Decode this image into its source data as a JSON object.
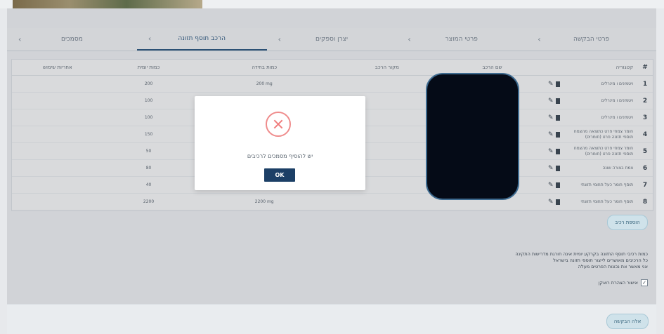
{
  "tabs": [
    {
      "label": "פרטי הבקשה"
    },
    {
      "label": "פרטי המוצר"
    },
    {
      "label": "יצרן וספקים"
    },
    {
      "label": "הרכב תוסף תזונה"
    },
    {
      "label": "מסמכים"
    }
  ],
  "table": {
    "headers": {
      "num": "#",
      "category": "קטגוריה",
      "name": "שם הרכב",
      "source": "מקור הרכב",
      "qty": "כמות בחידה",
      "daily_qty": "כמות יומית",
      "usage": "אחריות שימוש"
    },
    "rows": [
      {
        "num": "1",
        "category": "ויטמינים ו מינרלים",
        "qty": "200 mg",
        "daily": "200"
      },
      {
        "num": "2",
        "category": "ויטמינים ו מינרלים",
        "qty": "",
        "daily": "100"
      },
      {
        "num": "3",
        "category": "ויטמינים ו מינרלים",
        "qty": "",
        "daily": "100"
      },
      {
        "num": "4",
        "category": "חומר צמחי פרט כתוצאה מהצמח תוספי תזונה פרט (חומרים)",
        "qty": "",
        "daily": "150"
      },
      {
        "num": "5",
        "category": "חומר צמחי פרט כתוצאה מהצמח תוספי תזונה פרט (חומרים)",
        "qty": "",
        "daily": "50"
      },
      {
        "num": "6",
        "category": "צמח בצורה שונה",
        "qty": "",
        "daily": "80"
      },
      {
        "num": "7",
        "category": "תוסף חומר כעל תחומי תזונתי",
        "qty": "",
        "daily": "40"
      },
      {
        "num": "8",
        "category": "תוסף חומר כעל תחומי תזונתי",
        "qty": "2200 mg",
        "daily": "2200"
      }
    ]
  },
  "modal": {
    "message": "יש להוסיף מסמכים לרכיבים",
    "ok_label": "OK"
  },
  "add_button": "הוספת רכיב",
  "info_lines": [
    "כמות רכיבי תוסף התזונה בקרקע יומית אינה חורגת מדרישות התקינה",
    "כל הרכיבים מאושרים לייצור תוספי תזונה בישראל",
    "אני מאשר את נכונות הפרטים מעלה"
  ],
  "consent_label": "אישור הצהרת רואקן",
  "next_button": "אלה הבקשה",
  "colors": {
    "accent": "#1f4e79",
    "ok_button": "#1c3f66",
    "error": "#ef7c7c"
  }
}
